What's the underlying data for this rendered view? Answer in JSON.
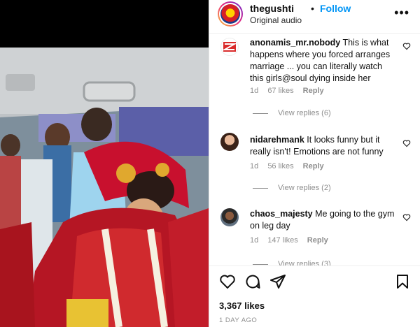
{
  "post": {
    "username": "thegushti",
    "separator": "•",
    "follow_label": "Follow",
    "audio": "Original audio",
    "more_icon": "more-horizontal-icon"
  },
  "comments": [
    {
      "user": "anonamis_mr.nobody",
      "text": "This is what happens where you forced arranges marriage ... you can literally watch this girls@soul dying inside her",
      "time": "1d",
      "likes": "67 likes",
      "reply": "Reply",
      "view_replies": "View replies (6)"
    },
    {
      "user": "nidarehmank",
      "text": "It looks funny but it really isn't! Emotions are not funny",
      "time": "1d",
      "likes": "56 likes",
      "reply": "Reply",
      "view_replies": "View replies (2)"
    },
    {
      "user": "chaos_majesty",
      "text": "Me going to the gym on leg day",
      "time": "1d",
      "likes": "147 likes",
      "reply": "Reply",
      "view_replies": "View replies (3)"
    }
  ],
  "actions": {
    "likes": "3,367 likes",
    "posted": "1 DAY AGO",
    "icons": [
      "heart-icon",
      "comment-icon",
      "share-icon",
      "save-icon"
    ]
  },
  "colors": {
    "accent": "#0095f6",
    "muted": "#8e8e8e"
  }
}
